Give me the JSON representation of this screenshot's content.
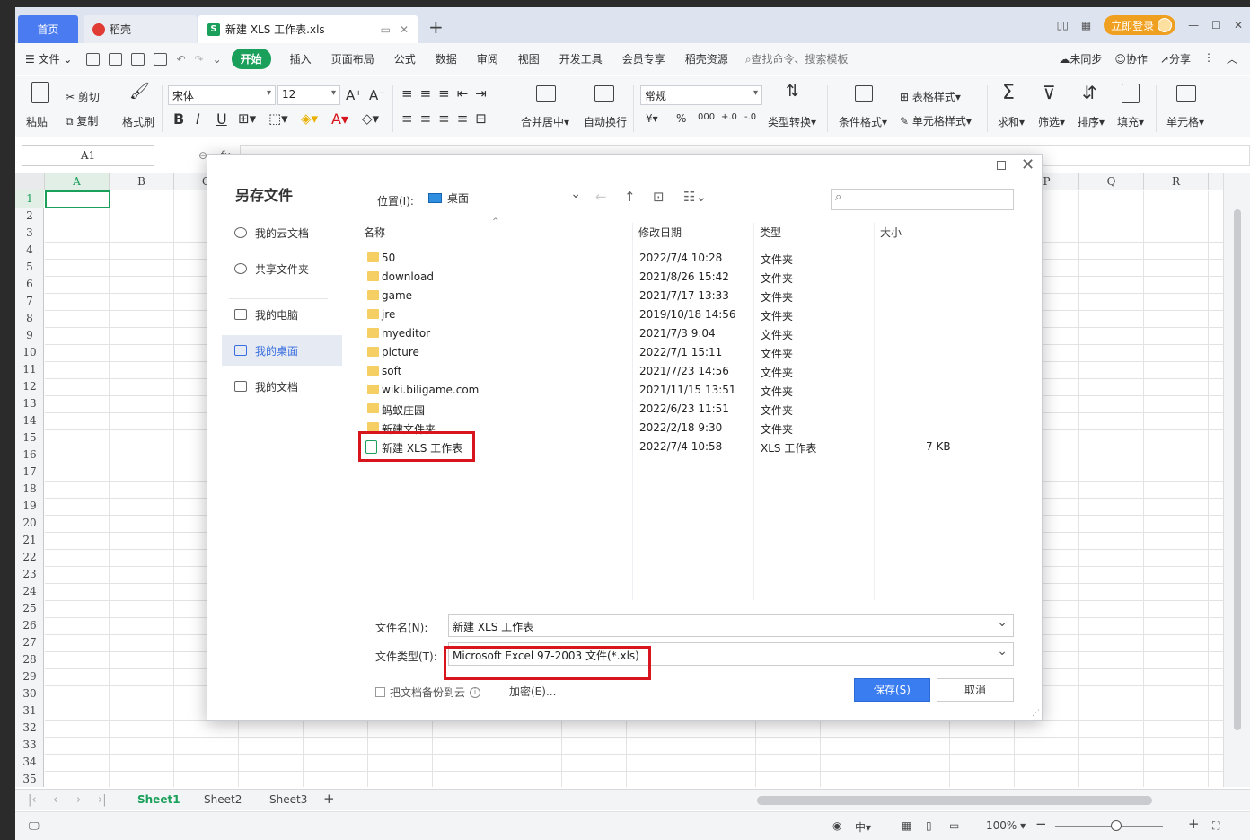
{
  "titlebar": {
    "tab_home": "首页",
    "tab_docer": "稻壳",
    "tab_file": "新建 XLS 工作表.xls",
    "add_tab": "+",
    "login": "立即登录"
  },
  "menubar": {
    "file": "文件",
    "items": [
      "开始",
      "插入",
      "页面布局",
      "公式",
      "数据",
      "审阅",
      "视图",
      "开发工具",
      "会员专享",
      "稻壳资源"
    ],
    "search": "查找命令、搜索模板",
    "unsync": "未同步",
    "collab": "协作",
    "share": "分享"
  },
  "ribbon": {
    "paste": "粘贴",
    "cut": "剪切",
    "copy": "复制",
    "format_painter": "格式刷",
    "font_name": "宋体",
    "font_size": "12",
    "merge": "合并居中",
    "wrap": "自动换行",
    "number_format": "常规",
    "convert": "类型转换",
    "cond_format": "条件格式",
    "table_style": "表格样式",
    "cell_style": "单元格样式",
    "sum": "求和",
    "filter": "筛选",
    "sort": "排序",
    "fill": "填充",
    "cell": "单元格",
    "yuan": "¥",
    "percent": "%",
    "thousands": "000",
    "dec_inc": "+.0",
    "dec_dec": "-.0"
  },
  "formula": {
    "cell_ref": "A1",
    "fx": "fx"
  },
  "grid": {
    "columns_left": [
      "A",
      "B",
      "C"
    ],
    "columns_right": [
      "P",
      "Q",
      "R"
    ],
    "rows": [
      "1",
      "2",
      "3",
      "4",
      "5",
      "6",
      "7",
      "8",
      "9",
      "10",
      "11",
      "12",
      "13",
      "14",
      "15",
      "16",
      "17",
      "18",
      "19",
      "20",
      "21",
      "22",
      "23",
      "24",
      "25",
      "26",
      "27",
      "28",
      "29",
      "30",
      "31",
      "32",
      "33",
      "34",
      "35"
    ]
  },
  "sheets": {
    "tabs": [
      "Sheet1",
      "Sheet2",
      "Sheet3"
    ],
    "add": "+"
  },
  "status": {
    "zoom": "100%",
    "lang": "中"
  },
  "dialog": {
    "title": "另存文件",
    "nav": [
      "我的云文档",
      "共享文件夹",
      "我的电脑",
      "我的桌面",
      "我的文档"
    ],
    "location_label": "位置(I):",
    "location_value": "桌面",
    "col_name": "名称",
    "col_date": "修改日期",
    "col_type": "类型",
    "col_size": "大小",
    "files": [
      {
        "name": "50",
        "date": "2022/7/4 10:28",
        "type": "文件夹",
        "size": ""
      },
      {
        "name": "download",
        "date": "2021/8/26 15:42",
        "type": "文件夹",
        "size": ""
      },
      {
        "name": "game",
        "date": "2021/7/17 13:33",
        "type": "文件夹",
        "size": ""
      },
      {
        "name": "jre",
        "date": "2019/10/18 14:56",
        "type": "文件夹",
        "size": ""
      },
      {
        "name": "myeditor",
        "date": "2021/7/3 9:04",
        "type": "文件夹",
        "size": ""
      },
      {
        "name": "picture",
        "date": "2022/7/1 15:11",
        "type": "文件夹",
        "size": ""
      },
      {
        "name": "soft",
        "date": "2021/7/23 14:56",
        "type": "文件夹",
        "size": ""
      },
      {
        "name": "wiki.biligame.com",
        "date": "2021/11/15 13:51",
        "type": "文件夹",
        "size": ""
      },
      {
        "name": "蚂蚁庄园",
        "date": "2022/6/23 11:51",
        "type": "文件夹",
        "size": ""
      },
      {
        "name": "新建文件夹",
        "date": "2022/2/18 9:30",
        "type": "文件夹",
        "size": ""
      },
      {
        "name": "新建 XLS 工作表",
        "date": "2022/7/4 10:58",
        "type": "XLS 工作表",
        "size": "7 KB"
      }
    ],
    "filename_label": "文件名(N):",
    "filename_value": "新建 XLS 工作表",
    "filetype_label": "文件类型(T):",
    "filetype_value": "Microsoft Excel 97-2003 文件(*.xls)",
    "backup_label": "把文档备份到云",
    "encrypt": "加密(E)...",
    "save": "保存(S)",
    "cancel": "取消"
  }
}
